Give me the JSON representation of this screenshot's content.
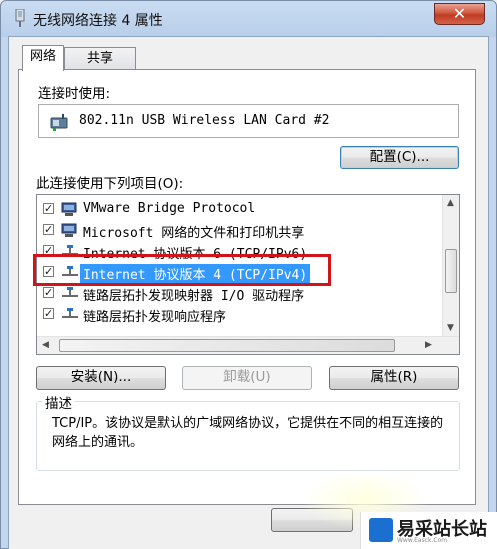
{
  "window": {
    "title": "无线网络连接 4 属性",
    "close_label": "✕"
  },
  "tabs": [
    {
      "label": "网络",
      "active": true
    },
    {
      "label": "共享",
      "active": false
    }
  ],
  "connect_using": {
    "label": "连接时使用:",
    "adapter": "802.11n USB Wireless LAN Card #2",
    "configure_button": "配置(C)..."
  },
  "items_section": {
    "label": "此连接使用下列项目(O):",
    "items": [
      {
        "text": "VMware Bridge Protocol",
        "checked": true,
        "icon": "network-adapter-icon"
      },
      {
        "text": "Microsoft 网络的文件和打印机共享",
        "checked": true,
        "icon": "network-adapter-icon"
      },
      {
        "text": "Internet 协议版本 6 (TCP/IPv6)",
        "checked": true,
        "icon": "protocol-icon"
      },
      {
        "text": "Internet 协议版本 4 (TCP/IPv4)",
        "checked": true,
        "icon": "protocol-icon",
        "selected": true
      },
      {
        "text": "链路层拓扑发现映射器 I/O 驱动程序",
        "checked": true,
        "icon": "protocol-icon"
      },
      {
        "text": "链路层拓扑发现响应程序",
        "checked": true,
        "icon": "protocol-icon"
      }
    ]
  },
  "buttons": {
    "install": "安装(N)...",
    "uninstall": "卸载(U)",
    "properties": "属性(R)"
  },
  "description": {
    "title": "描述",
    "text": "TCP/IP。该协议是默认的广域网络协议，它提供在不同的相互连接的网络上的通讯。"
  },
  "watermark": {
    "text": "易采站长站",
    "sub": "Www.Easck.Com"
  },
  "colors": {
    "highlight_border": "#d0141a",
    "selection": "#3399ff",
    "close_button": "#c13a22"
  }
}
